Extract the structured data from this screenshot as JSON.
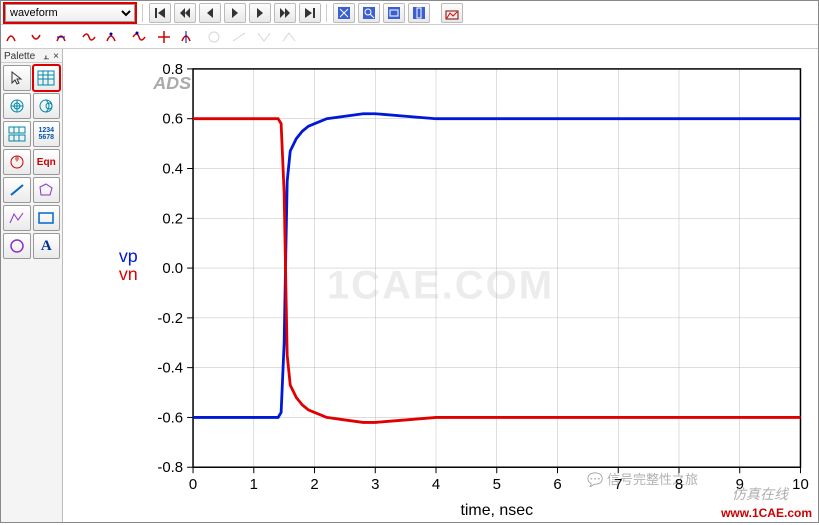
{
  "toolbar": {
    "dropdown_value": "waveform",
    "nav_icons": [
      "first",
      "prev-chapter",
      "prev",
      "play",
      "next",
      "next-chapter",
      "last"
    ],
    "zoom_icons": [
      "zoom-select",
      "zoom-out",
      "zoom-rect",
      "zoom-column",
      "chart-props"
    ]
  },
  "toolbar2": {
    "marker_icons": [
      "marker-a",
      "marker-b",
      "marker-c",
      "marker-d",
      "marker-e",
      "marker-f",
      "marker-clear",
      "marker-g",
      "marker-h",
      "marker-i",
      "marker-j",
      "marker-k"
    ]
  },
  "palette": {
    "title": "Palette",
    "items": [
      {
        "name": "select-tool",
        "highlight": false
      },
      {
        "name": "rect-plot-tool",
        "highlight": true
      },
      {
        "name": "polar-plot-tool",
        "highlight": false
      },
      {
        "name": "smith-plot-tool",
        "highlight": false
      },
      {
        "name": "stacked-plot-tool",
        "highlight": false
      },
      {
        "name": "list-tool",
        "highlight": false,
        "label": "1234\n5678"
      },
      {
        "name": "antenna-plot-tool",
        "highlight": false
      },
      {
        "name": "equation-tool",
        "highlight": false,
        "label": "Eqn"
      },
      {
        "name": "line-tool",
        "highlight": false
      },
      {
        "name": "polygon-tool",
        "highlight": false
      },
      {
        "name": "polyline-tool",
        "highlight": false
      },
      {
        "name": "rectangle-tool",
        "highlight": false
      },
      {
        "name": "circle-tool",
        "highlight": false
      },
      {
        "name": "text-tool",
        "highlight": false,
        "label": "A"
      }
    ]
  },
  "chart_data": {
    "type": "line",
    "title": "",
    "xlabel": "time, nsec",
    "ylabel_vp": "vp",
    "ylabel_vn": "vn",
    "ads_label": "ADS",
    "xlim": [
      0,
      10
    ],
    "ylim": [
      -0.8,
      0.8
    ],
    "xticks": [
      0,
      1,
      2,
      3,
      4,
      5,
      6,
      7,
      8,
      9,
      10
    ],
    "yticks": [
      -0.8,
      -0.6,
      -0.4,
      -0.2,
      0.0,
      0.2,
      0.4,
      0.6,
      0.8
    ],
    "x": [
      0.0,
      0.5,
      1.0,
      1.3,
      1.4,
      1.45,
      1.5,
      1.53,
      1.55,
      1.6,
      1.7,
      1.8,
      1.9,
      2.0,
      2.2,
      2.5,
      2.8,
      3.0,
      3.5,
      4.0,
      5.0,
      6.0,
      7.0,
      8.0,
      9.0,
      10.0
    ],
    "series": [
      {
        "name": "vp",
        "color": "#0018d8",
        "values": [
          -0.6,
          -0.6,
          -0.6,
          -0.6,
          -0.6,
          -0.58,
          -0.3,
          0.1,
          0.35,
          0.47,
          0.52,
          0.55,
          0.57,
          0.58,
          0.6,
          0.61,
          0.62,
          0.62,
          0.61,
          0.6,
          0.6,
          0.6,
          0.6,
          0.6,
          0.6,
          0.6
        ]
      },
      {
        "name": "vn",
        "color": "#e00000",
        "values": [
          0.6,
          0.6,
          0.6,
          0.6,
          0.6,
          0.58,
          0.3,
          -0.1,
          -0.35,
          -0.47,
          -0.52,
          -0.55,
          -0.57,
          -0.58,
          -0.6,
          -0.61,
          -0.62,
          -0.62,
          -0.61,
          -0.6,
          -0.6,
          -0.6,
          -0.6,
          -0.6,
          -0.6,
          -0.6
        ]
      }
    ]
  },
  "watermarks": {
    "center": "1CAE.COM",
    "wechat": "信号完整性之旅",
    "zh": "仿真在线",
    "url": "www.1CAE.com"
  }
}
